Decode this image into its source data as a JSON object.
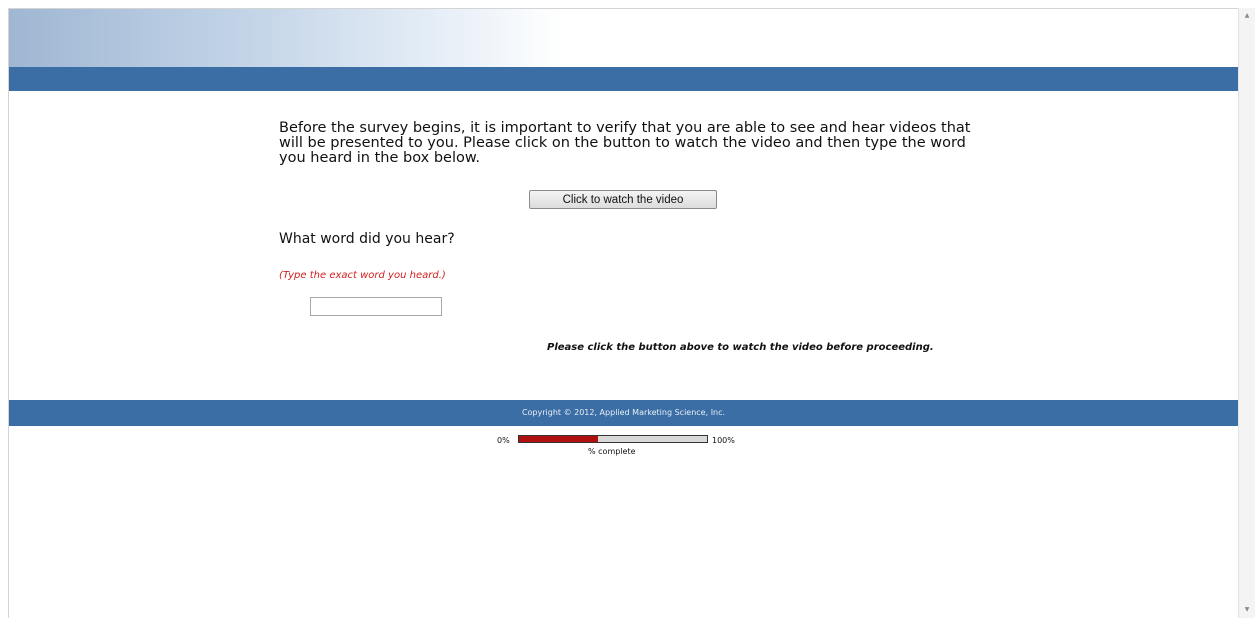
{
  "survey": {
    "intro_text": "Before the survey begins, it is important to verify that you are able to see and hear videos that will be presented to you. Please click on the button to watch the video and then type the word you heard in the box below.",
    "watch_button_label": "Click to watch the video",
    "question": "What word did you hear?",
    "hint": "(Type the exact word you heard.)",
    "answer_value": "",
    "notice": "Please click the button above to watch the video before proceeding."
  },
  "footer": {
    "copyright": "Copyright © 2012, Applied Marketing Science, Inc."
  },
  "progress": {
    "min_label": "0%",
    "max_label": "100%",
    "caption": "% complete",
    "fraction": 0.42,
    "fill_color": "#b01010",
    "track_color": "#d9d9d9"
  },
  "colors": {
    "header_bar": "#3a6ea5",
    "hint_text": "#d42020"
  },
  "icons": {
    "scroll_up": "triangle-up",
    "scroll_down": "triangle-down"
  }
}
